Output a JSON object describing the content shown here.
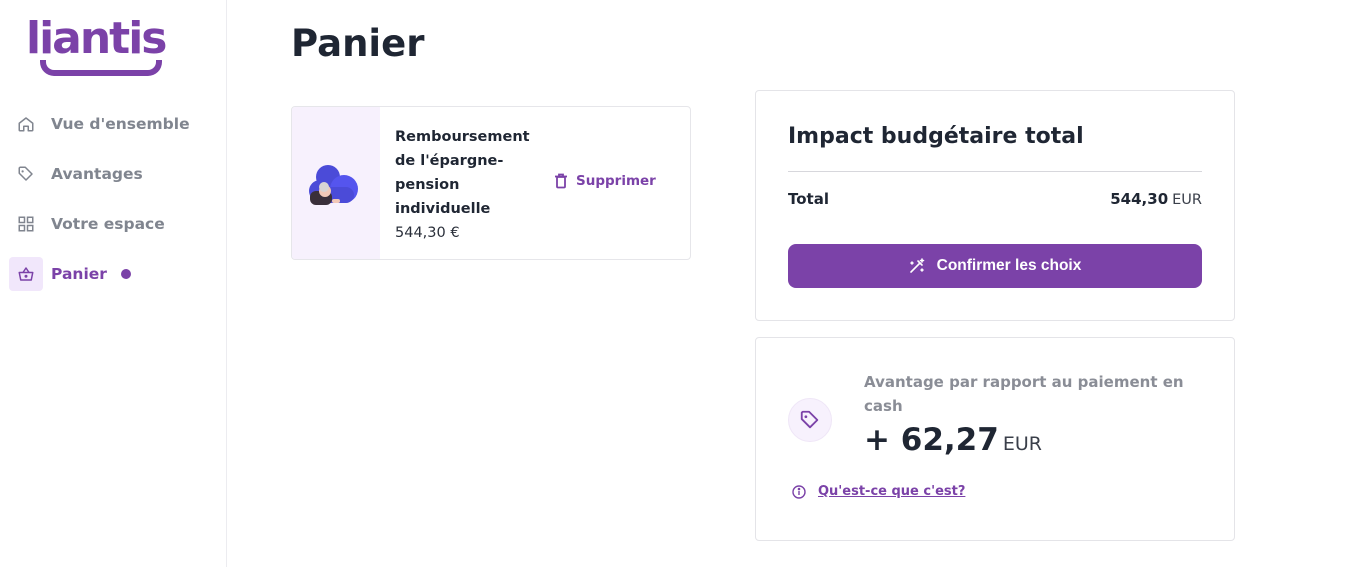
{
  "brand": {
    "logo_text": "liantis",
    "accent_color": "#7b42a8"
  },
  "sidebar": {
    "items": [
      {
        "label": "Vue d'ensemble",
        "icon": "home-icon"
      },
      {
        "label": "Avantages",
        "icon": "tag-icon"
      },
      {
        "label": "Votre espace",
        "icon": "grid-icon"
      },
      {
        "label": "Panier",
        "icon": "basket-icon",
        "active": true,
        "has_notification_dot": true
      }
    ]
  },
  "main": {
    "title": "Panier",
    "cart_items": [
      {
        "name": "Remboursement de l'épargne-pension individuelle",
        "price": "544,30 €",
        "delete_label": "Supprimer",
        "icon": "pension-illustration"
      }
    ],
    "summary": {
      "heading": "Impact budgétaire total",
      "total_label": "Total",
      "total_amount": "544,30",
      "total_currency": "EUR",
      "confirm_label": "Confirmer les choix"
    },
    "advantage": {
      "label": "Avantage par rapport au paiement en cash",
      "amount": "+ 62,27",
      "currency": "EUR",
      "info_link": "Qu'est-ce que c'est?"
    }
  }
}
